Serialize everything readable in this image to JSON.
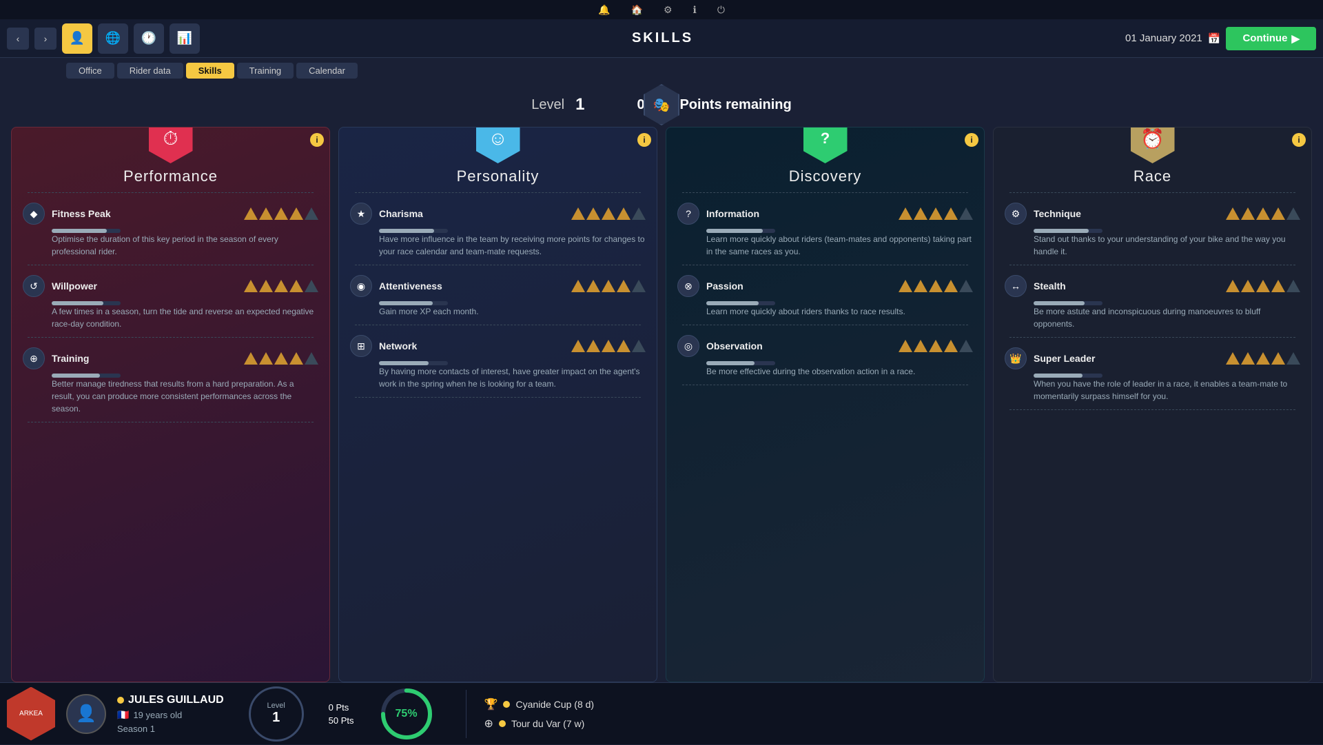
{
  "topbar": {
    "icons": [
      "🔔",
      "🏠",
      "⚙",
      "ℹ",
      "⏻"
    ]
  },
  "navbar": {
    "title": "SKILLS",
    "date": "01 January 2021",
    "continue_label": "Continue",
    "nav_icons": [
      {
        "name": "rider-icon",
        "symbol": "👤",
        "active": true
      },
      {
        "name": "globe-icon",
        "symbol": "🌐",
        "active": false
      },
      {
        "name": "clock-icon",
        "symbol": "🕐",
        "active": false
      },
      {
        "name": "chart-icon",
        "symbol": "📊",
        "active": false
      }
    ]
  },
  "subnav": {
    "tabs": [
      {
        "label": "Office",
        "active": false
      },
      {
        "label": "Rider data",
        "active": false
      },
      {
        "label": "Skills",
        "active": true
      },
      {
        "label": "Training",
        "active": false
      },
      {
        "label": "Calendar",
        "active": false
      }
    ]
  },
  "levelbar": {
    "level_label": "Level",
    "level_value": "1",
    "skill_points": "0",
    "skill_points_label": "Skill Points remaining",
    "hex_icon": "🎭"
  },
  "cards": [
    {
      "id": "performance",
      "title": "Performance",
      "hex_color": "hex-red",
      "hex_icon": "⏱",
      "skills": [
        {
          "name": "Fitness Peak",
          "icon": "◆",
          "stars": 4,
          "max_stars": 5,
          "description": "Optimise the duration of this key period in the season of every professional rider."
        },
        {
          "name": "Willpower",
          "icon": "↺",
          "stars": 4,
          "max_stars": 5,
          "description": "A few times in a season, turn the tide and reverse an expected negative race-day condition."
        },
        {
          "name": "Training",
          "icon": "⊕",
          "stars": 4,
          "max_stars": 5,
          "description": "Better manage tiredness that results from a hard preparation. As a result, you can produce more consistent performances across the season."
        }
      ]
    },
    {
      "id": "personality",
      "title": "Personality",
      "hex_color": "hex-blue",
      "hex_icon": "☺",
      "skills": [
        {
          "name": "Charisma",
          "icon": "★",
          "stars": 4,
          "max_stars": 5,
          "description": "Have more influence in the team by receiving more points for changes to your race calendar and team-mate requests."
        },
        {
          "name": "Attentiveness",
          "icon": "◉",
          "stars": 4,
          "max_stars": 5,
          "description": "Gain more XP each month."
        },
        {
          "name": "Network",
          "icon": "⊞",
          "stars": 4,
          "max_stars": 5,
          "description": "By having more contacts of interest, have greater impact on the agent's work in the spring when he is looking for a team."
        }
      ]
    },
    {
      "id": "discovery",
      "title": "Discovery",
      "hex_color": "hex-green",
      "hex_icon": "?",
      "skills": [
        {
          "name": "Information",
          "icon": "?",
          "stars": 4,
          "max_stars": 5,
          "description": "Learn more quickly about riders (team-mates and opponents) taking part in the same races as you."
        },
        {
          "name": "Passion",
          "icon": "⊗",
          "stars": 4,
          "max_stars": 5,
          "description": "Learn more quickly about riders thanks to race results."
        },
        {
          "name": "Observation",
          "icon": "◎",
          "stars": 4,
          "max_stars": 5,
          "description": "Be more effective during the observation action in a race."
        }
      ]
    },
    {
      "id": "race",
      "title": "Race",
      "hex_color": "hex-gold",
      "hex_icon": "⏰",
      "skills": [
        {
          "name": "Technique",
          "icon": "⚙",
          "stars": 4,
          "max_stars": 5,
          "description": "Stand out thanks to your understanding of your bike and the way you handle it."
        },
        {
          "name": "Stealth",
          "icon": "↔",
          "stars": 4,
          "max_stars": 5,
          "description": "Be more astute and inconspicuous during manoeuvres to bluff opponents."
        },
        {
          "name": "Super Leader",
          "icon": "👑",
          "stars": 4,
          "max_stars": 5,
          "description": "When you have the role of leader in a race, it enables a team-mate to momentarily surpass himself for you."
        }
      ]
    }
  ],
  "bottombar": {
    "player_name": "JULES GUILLAUD",
    "player_age": "19 years old",
    "player_season": "Season 1",
    "level_label": "Level",
    "level_value": "1",
    "pts_current": "0 Pts",
    "pts_max": "50 Pts",
    "progress_pct": "75%",
    "races": [
      {
        "icon": "🏆",
        "label": "Cyanide Cup (8 d)"
      },
      {
        "icon": "⊕",
        "label": "Tour du Var (7 w)"
      }
    ]
  }
}
